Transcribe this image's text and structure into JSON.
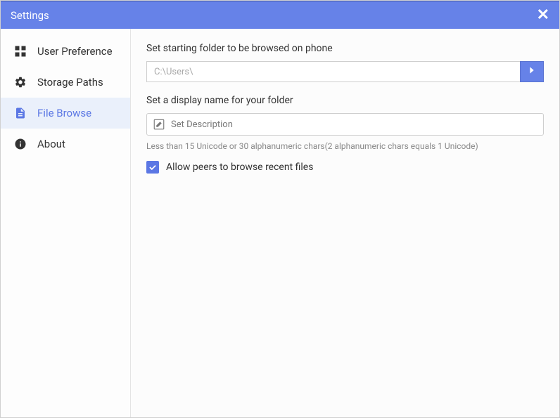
{
  "titlebar": {
    "title": "Settings"
  },
  "sidebar": {
    "items": [
      {
        "label": "User Preference"
      },
      {
        "label": "Storage Paths"
      },
      {
        "label": "File Browse"
      },
      {
        "label": "About"
      }
    ]
  },
  "content": {
    "starting_folder_label": "Set starting folder to be browsed on phone",
    "starting_folder_value": "C:\\Users\\",
    "display_name_label": "Set a display name for your folder",
    "display_name_placeholder": "Set Description",
    "hint": "Less than 15 Unicode or 30 alphanumeric chars(2 alphanumeric chars equals 1 Unicode)",
    "allow_peers_label": "Allow peers to browse recent files",
    "allow_peers_checked": true
  }
}
